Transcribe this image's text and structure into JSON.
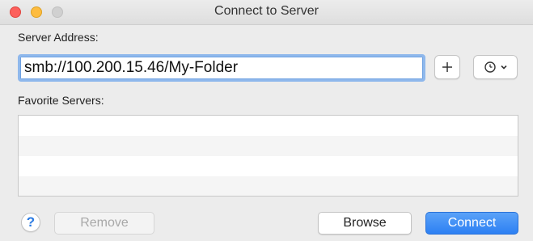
{
  "window": {
    "title": "Connect to Server"
  },
  "server_address": {
    "label": "Server Address:",
    "value": "smb://100.200.15.46/My-Folder"
  },
  "favorites": {
    "label": "Favorite Servers:",
    "items": []
  },
  "buttons": {
    "help": "?",
    "remove": "Remove",
    "browse": "Browse",
    "connect": "Connect"
  },
  "icons": {
    "add": "plus-icon",
    "recent": "clock-icon",
    "recent_menu": "chevron-down-icon"
  },
  "colors": {
    "accent": "#2d80f3",
    "focus_ring": "#8fb8ec"
  }
}
